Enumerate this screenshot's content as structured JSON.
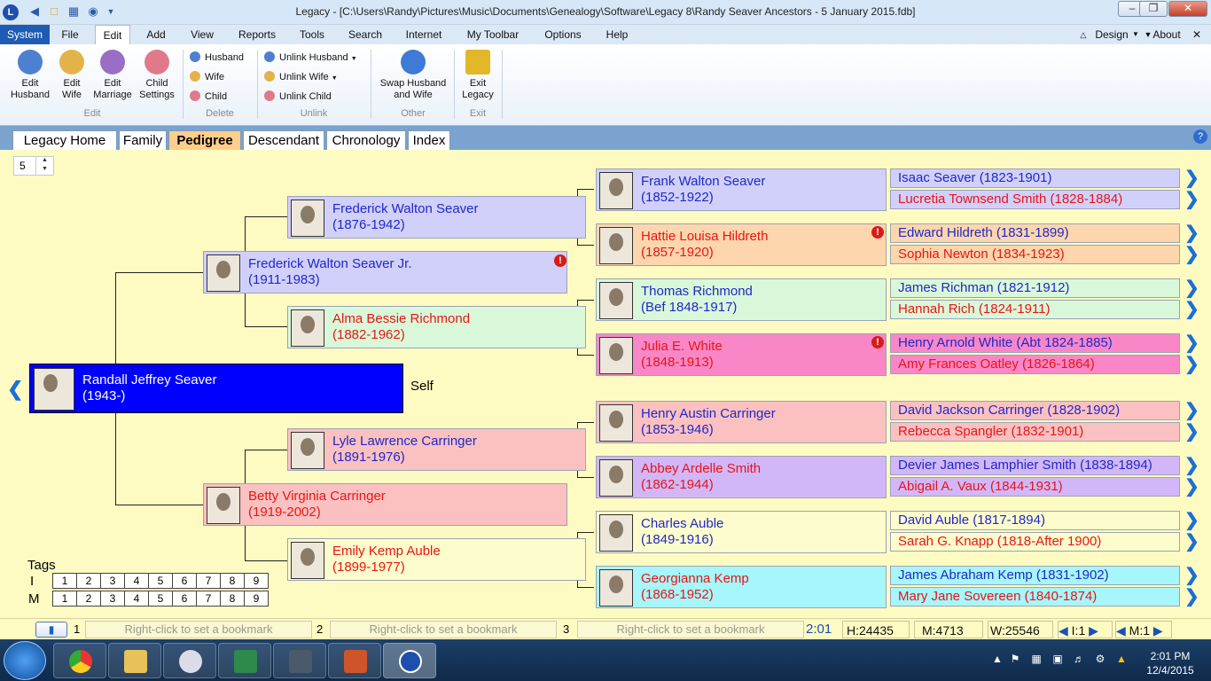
{
  "window": {
    "title": "Legacy - [C:\\Users\\Randy\\Pictures\\Music\\Documents\\Genealogy\\Software\\Legacy 8\\Randy Seaver Ancestors - 5 January 2015.fdb]",
    "minimize": "–",
    "maximize": "❐",
    "close": "✕"
  },
  "menu": {
    "system": "System",
    "file": "File",
    "edit": "Edit",
    "add": "Add",
    "view": "View",
    "reports": "Reports",
    "tools": "Tools",
    "search": "Search",
    "internet": "Internet",
    "my_toolbar": "My Toolbar",
    "options": "Options",
    "help": "Help",
    "design": "Design",
    "about": "About"
  },
  "ribbon": {
    "edit_husband": "Edit Husband",
    "edit_wife": "Edit Wife",
    "edit_marriage": "Edit Marriage",
    "child_settings": "Child Settings",
    "group_edit": "Edit",
    "del_husband": "Husband",
    "del_wife": "Wife",
    "del_child": "Child",
    "group_delete": "Delete",
    "unlink_husband": "Unlink Husband",
    "unlink_wife": "Unlink Wife",
    "unlink_child": "Unlink Child",
    "group_unlink": "Unlink",
    "swap": "Swap Husband and Wife",
    "group_other": "Other",
    "exit_legacy": "Exit Legacy",
    "group_exit": "Exit"
  },
  "tabs": {
    "legacy_home": "Legacy Home",
    "family": "Family",
    "pedigree": "Pedigree",
    "descendant": "Descendant",
    "chronology": "Chronology",
    "index": "Index"
  },
  "generations": "5",
  "self": {
    "name": "Randall Jeffrey Seaver",
    "dates": "(1943-)",
    "label": "Self"
  },
  "gen2": [
    {
      "name": "Frederick Walton Seaver Jr.",
      "dates": "(1911-1983)"
    },
    {
      "name": "Betty Virginia Carringer",
      "dates": "(1919-2002)"
    }
  ],
  "gen3": [
    {
      "name": "Frederick Walton Seaver",
      "dates": "(1876-1942)"
    },
    {
      "name": "Alma Bessie Richmond",
      "dates": "(1882-1962)"
    },
    {
      "name": "Lyle Lawrence Carringer",
      "dates": "(1891-1976)"
    },
    {
      "name": "Emily Kemp Auble",
      "dates": "(1899-1977)"
    }
  ],
  "gen4": [
    {
      "name": "Frank Walton Seaver",
      "dates": "(1852-1922)"
    },
    {
      "name": "Hattie Louisa Hildreth",
      "dates": "(1857-1920)"
    },
    {
      "name": "Thomas Richmond",
      "dates": "(Bef 1848-1917)"
    },
    {
      "name": "Julia E. White",
      "dates": "(1848-1913)"
    },
    {
      "name": "Henry Austin Carringer",
      "dates": "(1853-1946)"
    },
    {
      "name": "Abbey Ardelle Smith",
      "dates": "(1862-1944)"
    },
    {
      "name": "Charles Auble",
      "dates": "(1849-1916)"
    },
    {
      "name": "Georgianna Kemp",
      "dates": "(1868-1952)"
    }
  ],
  "gen5": [
    "Isaac Seaver (1823-1901)",
    "Lucretia Townsend Smith (1828-1884)",
    "Edward Hildreth (1831-1899)",
    "Sophia Newton (1834-1923)",
    "James Richman (1821-1912)",
    "Hannah Rich (1824-1911)",
    "Henry Arnold White (Abt 1824-1885)",
    "Amy Frances Oatley (1826-1864)",
    "David Jackson Carringer (1828-1902)",
    "Rebecca Spangler (1832-1901)",
    "Devier James Lamphier Smith (1838-1894)",
    "Abigail A. Vaux (1844-1931)",
    "David Auble (1817-1894)",
    "Sarah G. Knapp (1818-After 1900)",
    "James Abraham Kemp (1831-1902)",
    "Mary Jane Sovereen (1840-1874)"
  ],
  "tags": {
    "label": "Tags",
    "row_i": "I",
    "row_m": "M",
    "numbers": [
      "1",
      "2",
      "3",
      "4",
      "5",
      "6",
      "7",
      "8",
      "9"
    ]
  },
  "status": {
    "bm1": "1",
    "bm2": "2",
    "bm3": "3",
    "bookmark_hint": "Right-click to set a bookmark",
    "time": "2:01",
    "h": "H:24435",
    "m": "M:4713",
    "w": "W:25546",
    "i1": "I:1",
    "m1": "M:1"
  },
  "taskbar": {
    "time": "2:01 PM",
    "date": "12/4/2015"
  },
  "colors": {
    "background": "#fefbc2",
    "self_box": "#0000ff",
    "male_text": "#1f28c8",
    "female_text": "#e81515",
    "tab_active": "#ffce8a"
  },
  "icons": [
    "legacy-logo-icon",
    "back-icon",
    "folder-icon",
    "print-icon",
    "globe-icon",
    "warning-icon",
    "chevron-right-icon",
    "chevron-left-icon",
    "help-icon",
    "bookmark-icon"
  ]
}
